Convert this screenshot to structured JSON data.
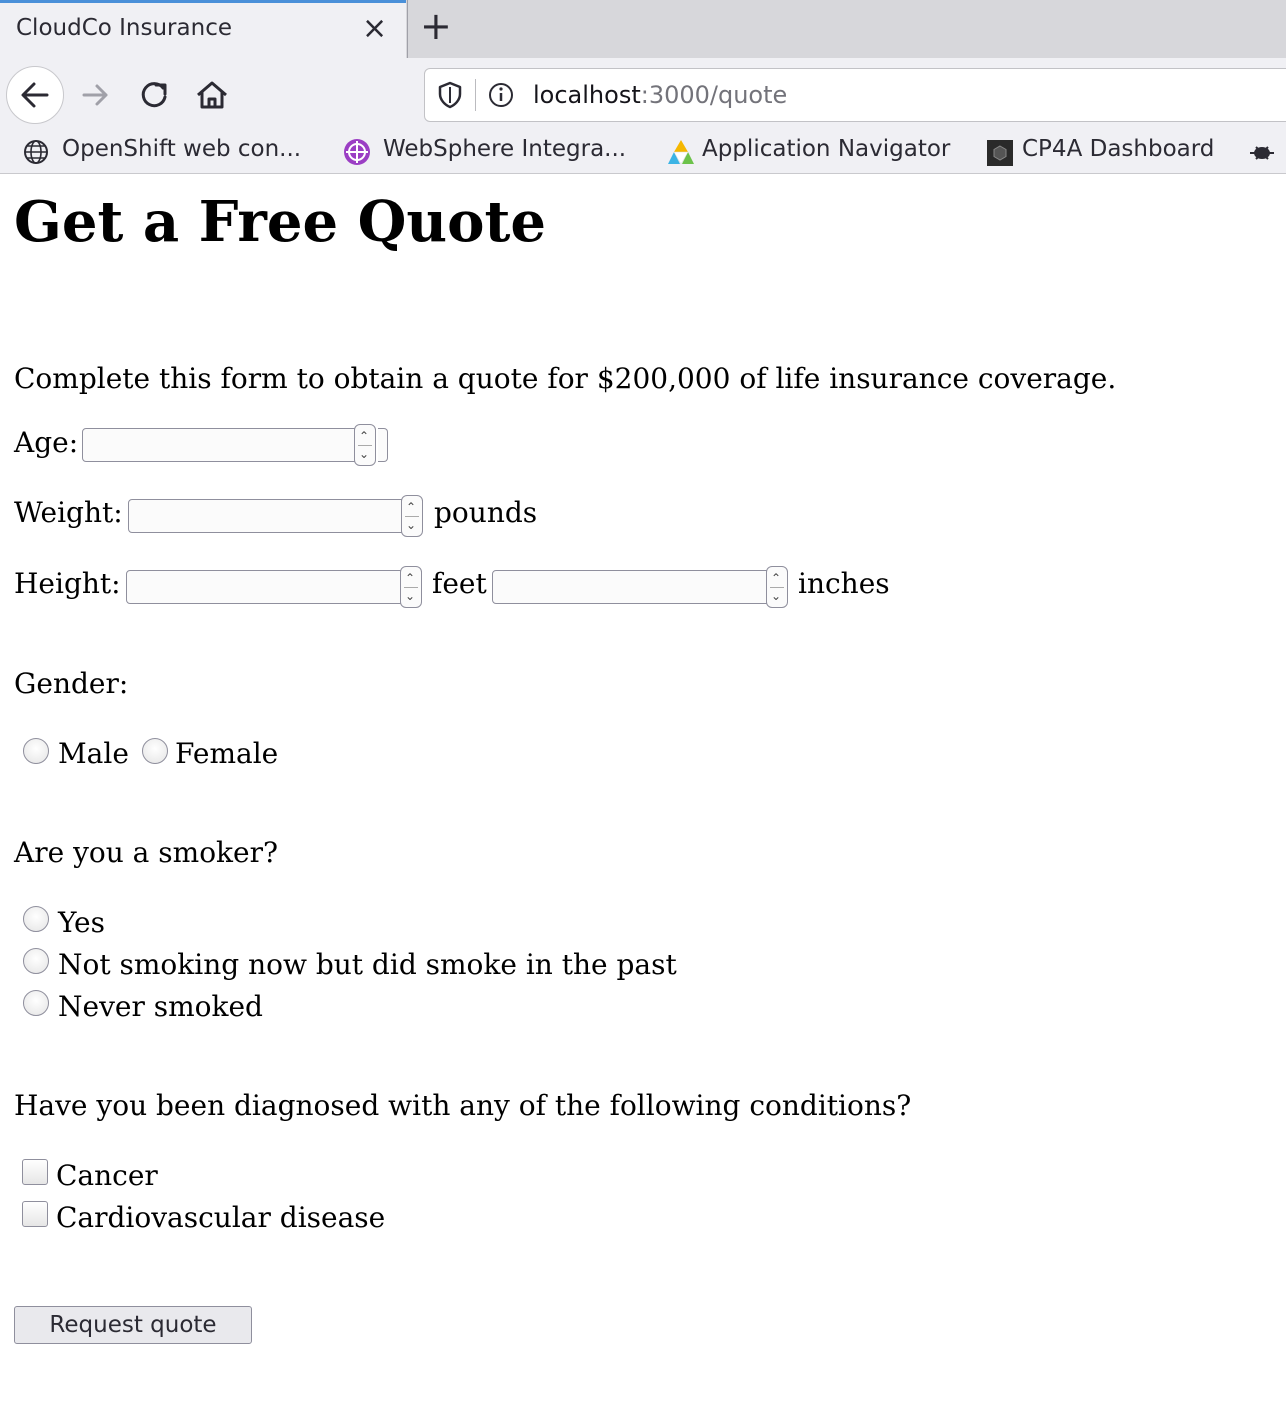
{
  "browser": {
    "tab_title": "CloudCo Insurance",
    "tab_close": "×",
    "new_tab": "+",
    "url_host": "localhost",
    "url_path": ":3000/quote",
    "bookmarks": [
      {
        "label": "OpenShift web con..."
      },
      {
        "label": "WebSphere Integra..."
      },
      {
        "label": "Application Navigator"
      },
      {
        "label": "CP4A Dashboard"
      }
    ]
  },
  "page": {
    "heading": "Get a Free Quote",
    "intro": "Complete this form to obtain a quote for $200,000 of life insurance coverage.",
    "age_label": "Age:",
    "weight_label": "Weight:",
    "weight_unit": "pounds",
    "height_label": "Height:",
    "height_feet_unit": "feet",
    "height_inches_unit": "inches",
    "gender_label": "Gender:",
    "gender_options": [
      "Male",
      "Female"
    ],
    "smoker_label": "Are you a smoker?",
    "smoker_options": [
      "Yes",
      "Not smoking now but did smoke in the past",
      "Never smoked"
    ],
    "conditions_label": "Have you been diagnosed with any of the following conditions?",
    "condition_options": [
      "Cancer",
      "Cardiovascular disease"
    ],
    "submit_label": "Request quote"
  }
}
